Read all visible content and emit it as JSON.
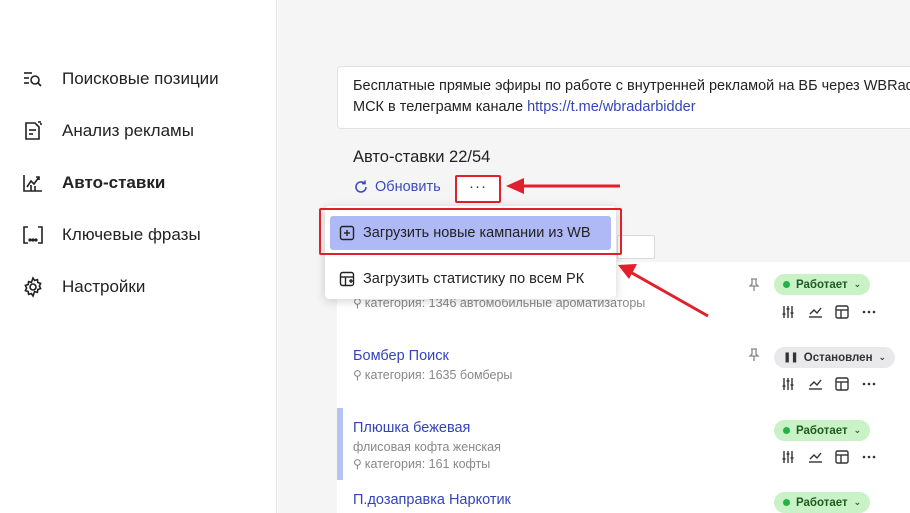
{
  "sidebar": {
    "items": [
      {
        "label": "Поисковые позиции",
        "icon": "search-list-icon",
        "active": false
      },
      {
        "label": "Анализ рекламы",
        "icon": "ad-analysis-icon",
        "active": false
      },
      {
        "label": "Авто-ставки",
        "icon": "chart-up-icon",
        "active": true
      },
      {
        "label": "Ключевые фразы",
        "icon": "brackets-icon",
        "active": false
      },
      {
        "label": "Настройки",
        "icon": "gear-icon",
        "active": false
      }
    ]
  },
  "banner": {
    "text_line1": "Бесплатные прямые эфиры по работе с внутренней рекламой на ВБ через WBRadarBidder",
    "text_line2_prefix": "МСК в телеграмм канале ",
    "link": "https://t.me/wbradarbidder"
  },
  "section": {
    "title": "Авто-ставки 22/54",
    "refresh_label": "Обновить",
    "more_label": "···"
  },
  "dropdown": {
    "items": [
      {
        "label": "Загрузить новые кампании из WB",
        "icon": "plus-square-icon"
      },
      {
        "label": "Загрузить статистику по всем РК",
        "icon": "table-stats-icon"
      }
    ]
  },
  "rows": [
    {
      "title": "",
      "subtitle": "",
      "search": "категория: 1346 автомобильные ароматизаторы",
      "status": "Работает",
      "status_type": "ok"
    },
    {
      "title": "Бомбер Поиск",
      "subtitle": "",
      "search": "категория: 1635 бомберы",
      "status": "Остановлен",
      "status_type": "stop"
    },
    {
      "title": "Плюшка бежевая",
      "subtitle": "флисовая кофта женская",
      "search": "категория: 161 кофты",
      "status": "Работает",
      "status_type": "ok"
    },
    {
      "title": "П.дозаправка Наркотик",
      "subtitle": "",
      "search": "",
      "status": "Работает",
      "status_type": "ok"
    }
  ],
  "colors": {
    "accent_link": "#3344bb",
    "annotation_red": "#e0202a",
    "status_ok_bg": "#c9f2c6",
    "status_dot": "#23b244",
    "highlight": "#aeb9f6"
  }
}
